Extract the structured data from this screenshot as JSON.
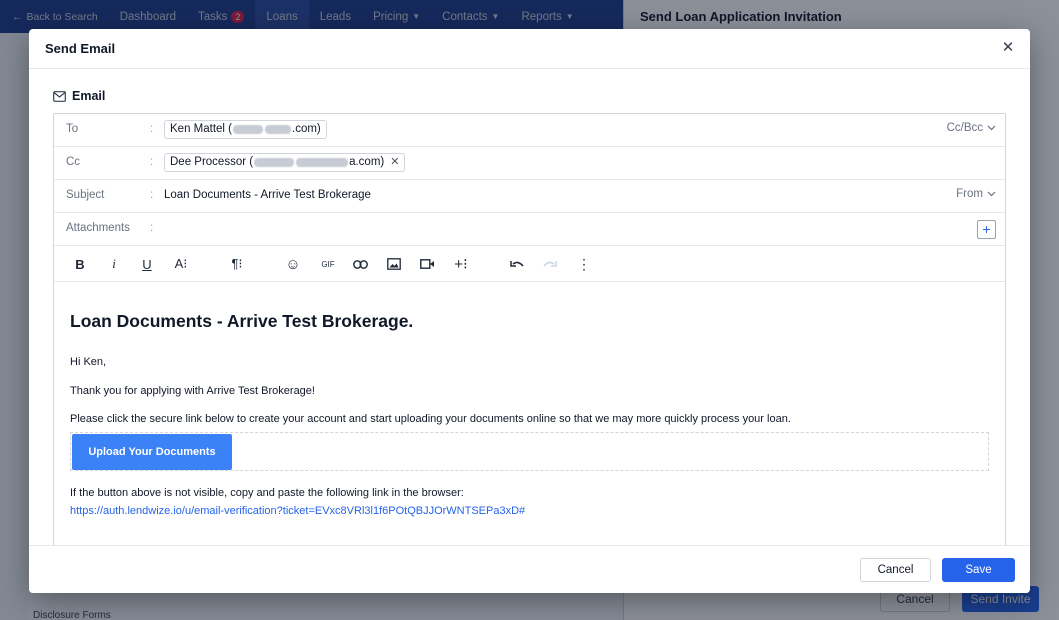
{
  "nav": {
    "back": "Back to Search",
    "items": [
      {
        "label": "Dashboard"
      },
      {
        "label": "Tasks",
        "badge": "2"
      },
      {
        "label": "Loans"
      },
      {
        "label": "Leads"
      },
      {
        "label": "Pricing"
      },
      {
        "label": "Contacts"
      },
      {
        "label": "Reports"
      }
    ]
  },
  "background": {
    "sidebar_item": "Disclosure Forms",
    "panel_title": "Send Loan Application Invitation",
    "panel_cancel": "Cancel",
    "panel_send": "Send Invite"
  },
  "modal": {
    "title": "Send Email",
    "close_icon": "close-icon",
    "section_label": "Email",
    "fields": {
      "to_label": "To",
      "to_chip_name": "Ken Mattel (",
      "to_chip_tail": ".com)",
      "cc_bcc": "Cc/Bcc",
      "cc_label": "Cc",
      "cc_chip_name": "Dee Processor (",
      "cc_chip_tail": "a.com)",
      "subject_label": "Subject",
      "subject_value": "Loan Documents - Arrive Test Brokerage",
      "from_toggle": "From",
      "attachments_label": "Attachments",
      "colon": ":"
    },
    "toolbar": {
      "bold": "B",
      "italic": "i",
      "underline": "U",
      "font_size": "A⁝",
      "paragraph": "¶⁝",
      "emoji": "☺",
      "gif": "GIF",
      "more": "⋮"
    },
    "body": {
      "heading": "Loan Documents - Arrive Test Brokerage.",
      "greeting": "Hi Ken,",
      "thanks": "Thank you for applying with Arrive Test Brokerage!",
      "instruction": "Please click the secure link below to create your account and start uploading your documents online so that we may more quickly process your loan.",
      "button": "Upload Your Documents",
      "fallback": "If the button above is not visible, copy and paste the following link in the browser:",
      "link": "https://auth.lendwize.io/u/email-verification?ticket=EVxc8VRl3l1f6POtQBJJOrWNTSEPa3xD#"
    },
    "footer": {
      "cancel": "Cancel",
      "save": "Save"
    }
  },
  "colors": {
    "primary": "#2563eb",
    "upload_button": "#3b82f6",
    "nav_background": "#1e3a8a"
  }
}
